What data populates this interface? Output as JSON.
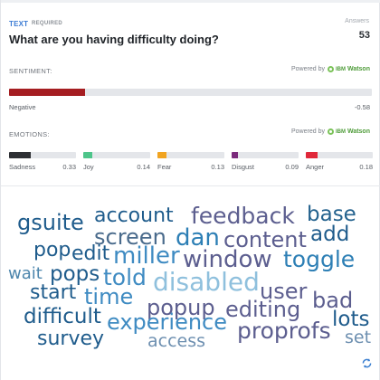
{
  "question": {
    "type_label": "TEXT",
    "required_label": "REQUIRED",
    "title": "What are you having difficulty doing?",
    "answers_label": "Answers",
    "answers_count": "53"
  },
  "sentiment": {
    "section_label": "SENTIMENT:",
    "powered_by": "Powered by",
    "provider_prefix": "IBM",
    "provider": "Watson",
    "label": "Negative",
    "value": "-0.58",
    "fill_fraction": 0.21,
    "color": "#a51d21"
  },
  "emotions": {
    "section_label": "EMOTIONS:",
    "powered_by": "Powered by",
    "provider_prefix": "IBM",
    "provider": "Watson",
    "items": [
      {
        "label": "Sadness",
        "value": "0.33",
        "fraction": 0.33,
        "color": "#2d2f33"
      },
      {
        "label": "Joy",
        "value": "0.14",
        "fraction": 0.14,
        "color": "#4ec58a"
      },
      {
        "label": "Fear",
        "value": "0.13",
        "fraction": 0.13,
        "color": "#f1a421"
      },
      {
        "label": "Disgust",
        "value": "0.09",
        "fraction": 0.09,
        "color": "#7b2a7c"
      },
      {
        "label": "Anger",
        "value": "0.18",
        "fraction": 0.18,
        "color": "#e0283a"
      }
    ]
  },
  "word_cloud": {
    "words": [
      {
        "text": "gsuite",
        "color": "#1f5c8c"
      },
      {
        "text": "account",
        "color": "#1f5c8c"
      },
      {
        "text": "feedback",
        "color": "#5c5e8f"
      },
      {
        "text": "base",
        "color": "#24628e"
      },
      {
        "text": "screen",
        "color": "#4a6b8c"
      },
      {
        "text": "dan",
        "color": "#2d7fb5"
      },
      {
        "text": "content",
        "color": "#5c5e8f"
      },
      {
        "text": "add",
        "color": "#1f5c8c"
      },
      {
        "text": "pop",
        "color": "#1f5c8c"
      },
      {
        "text": "edit",
        "color": "#1f5c8c"
      },
      {
        "text": "miller",
        "color": "#3f8bc2"
      },
      {
        "text": "window",
        "color": "#5c5e8f"
      },
      {
        "text": "toggle",
        "color": "#2d7fb5"
      },
      {
        "text": "wait",
        "color": "#4d86ad"
      },
      {
        "text": "pops",
        "color": "#1f5c8c"
      },
      {
        "text": "told",
        "color": "#3f8bc2"
      },
      {
        "text": "disabled",
        "color": "#8fc0dd"
      },
      {
        "text": "start",
        "color": "#1f5c8c"
      },
      {
        "text": "time",
        "color": "#3f8bc2"
      },
      {
        "text": "user",
        "color": "#5c5e8f"
      },
      {
        "text": "bad",
        "color": "#5c5e8f"
      },
      {
        "text": "popup",
        "color": "#5c5e8f"
      },
      {
        "text": "editing",
        "color": "#5c5e8f"
      },
      {
        "text": "difficult",
        "color": "#1f5c8c"
      },
      {
        "text": "experience",
        "color": "#3f8bc2"
      },
      {
        "text": "lots",
        "color": "#1f5c8c"
      },
      {
        "text": "proprofs",
        "color": "#5c5e8f"
      },
      {
        "text": "survey",
        "color": "#1f5c8c"
      },
      {
        "text": "access",
        "color": "#6d8fb0"
      },
      {
        "text": "set",
        "color": "#6d8fb0"
      }
    ]
  },
  "icons": {
    "provider_logo": "ibm-watson-logo",
    "refresh": "refresh-icon"
  }
}
